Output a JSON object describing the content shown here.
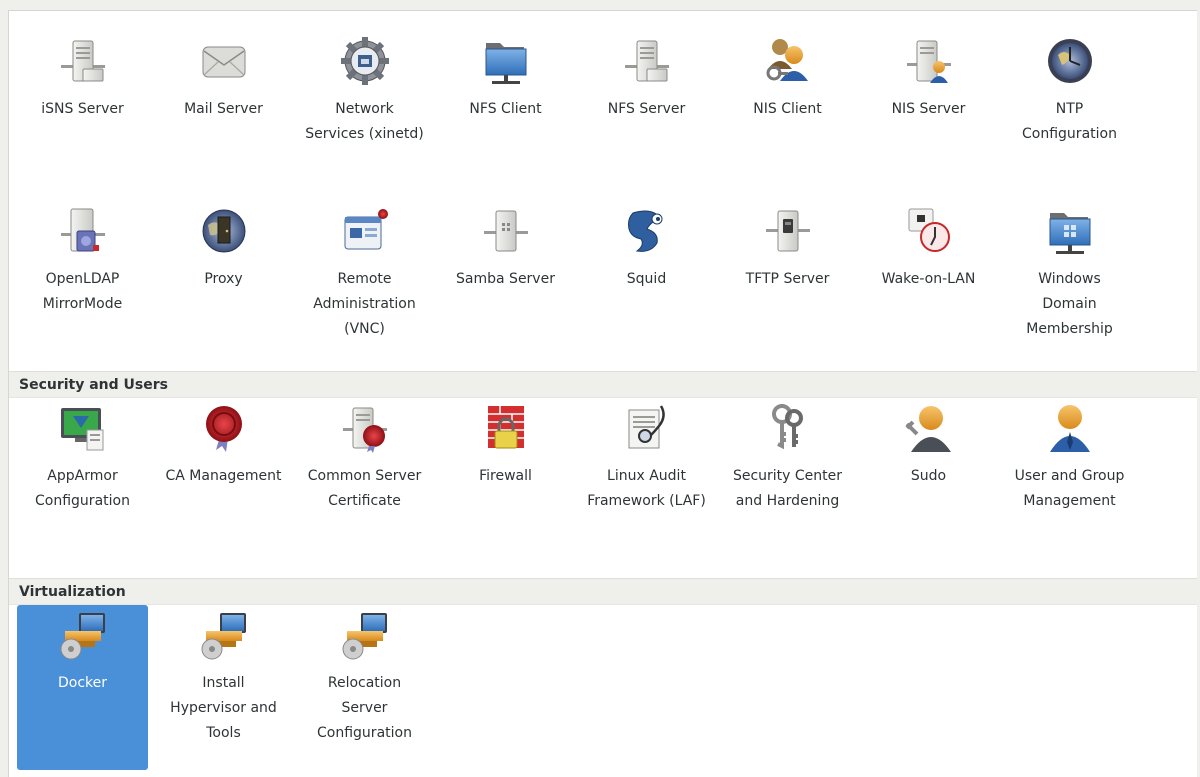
{
  "network_services": {
    "row1": [
      {
        "label": "iSNS Server",
        "icon": "server-icon"
      },
      {
        "label": "Mail Server",
        "icon": "mail-envelope-icon"
      },
      {
        "label": "Network Services (xinetd)",
        "icon": "network-gear-icon"
      },
      {
        "label": "NFS Client",
        "icon": "network-folder-icon"
      },
      {
        "label": "NFS Server",
        "icon": "server-icon"
      },
      {
        "label": "NIS Client",
        "icon": "users-keys-icon"
      },
      {
        "label": "NIS Server",
        "icon": "server-user-icon"
      },
      {
        "label": "NTP Configuration",
        "icon": "clock-globe-icon"
      }
    ],
    "row2": [
      {
        "label": "OpenLDAP MirrorMode",
        "icon": "ldap-server-icon"
      },
      {
        "label": "Proxy",
        "icon": "globe-door-icon"
      },
      {
        "label": "Remote Administration (VNC)",
        "icon": "remote-window-icon"
      },
      {
        "label": "Samba Server",
        "icon": "samba-server-icon"
      },
      {
        "label": "Squid",
        "icon": "squid-icon"
      },
      {
        "label": "TFTP Server",
        "icon": "tftp-server-icon"
      },
      {
        "label": "Wake-on-LAN",
        "icon": "wake-on-lan-icon"
      },
      {
        "label": "Windows Domain Membership",
        "icon": "windows-folder-icon"
      }
    ]
  },
  "security": {
    "title": "Security and Users",
    "items": [
      {
        "label": "AppArmor Configuration",
        "icon": "apparmor-monitor-icon"
      },
      {
        "label": "CA Management",
        "icon": "certificate-seal-icon"
      },
      {
        "label": "Common Server Certificate",
        "icon": "server-certificate-icon"
      },
      {
        "label": "Firewall",
        "icon": "firewall-lock-icon"
      },
      {
        "label": "Linux Audit Framework (LAF)",
        "icon": "audit-stethoscope-icon"
      },
      {
        "label": "Security Center and Hardening",
        "icon": "keys-icon"
      },
      {
        "label": "Sudo",
        "icon": "sudo-user-icon"
      },
      {
        "label": "User and Group Management",
        "icon": "user-icon"
      }
    ]
  },
  "virtualization": {
    "title": "Virtualization",
    "items": [
      {
        "label": "Docker",
        "icon": "install-computer-icon",
        "selected": true
      },
      {
        "label": "Install Hypervisor and Tools",
        "icon": "install-computer-icon"
      },
      {
        "label": "Relocation Server Configuration",
        "icon": "install-computer-icon"
      }
    ]
  },
  "colors": {
    "selection": "#4a90d9",
    "header_bg": "#efefec"
  }
}
